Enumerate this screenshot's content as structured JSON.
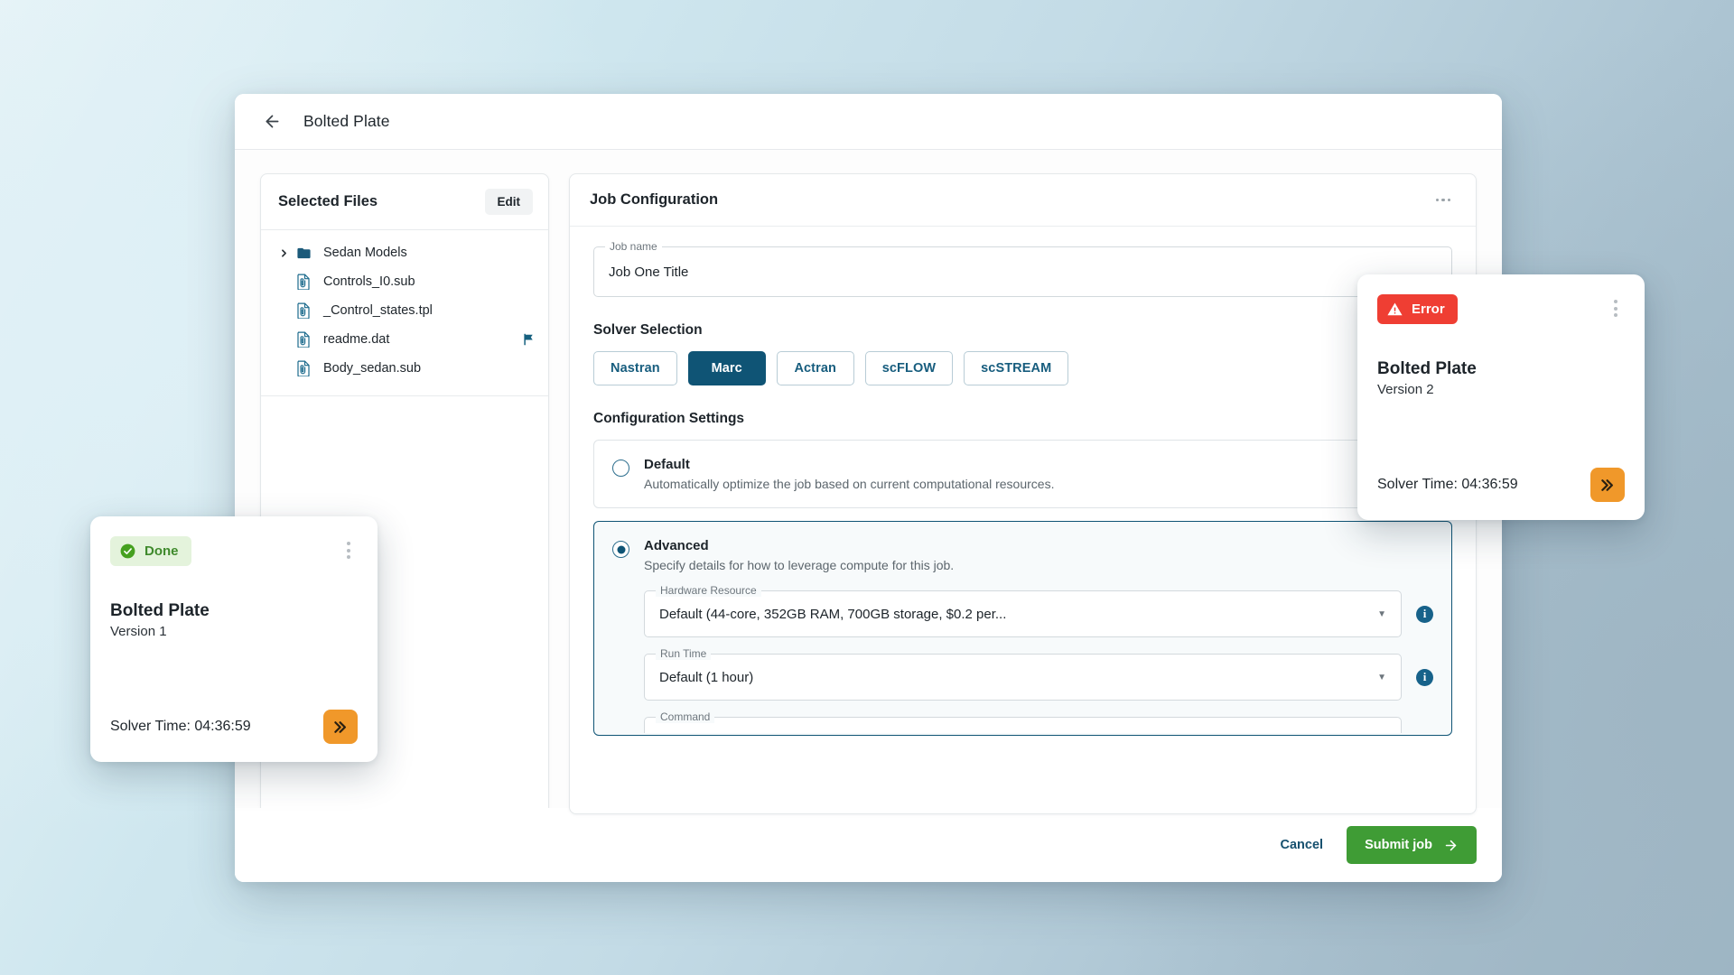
{
  "window": {
    "title": "Bolted Plate",
    "back_icon": "arrow-left-icon"
  },
  "files_panel": {
    "title": "Selected Files",
    "edit_label": "Edit",
    "items": [
      {
        "label": "Sedan Models",
        "type": "folder",
        "icon": "folder-icon",
        "expandable": true,
        "chevron": "chevron-right-icon",
        "flagged": false
      },
      {
        "label": "Controls_I0.sub",
        "type": "file",
        "icon": "file-document-icon",
        "expandable": false,
        "flagged": false
      },
      {
        "label": "_Control_states.tpl",
        "type": "file",
        "icon": "file-document-icon",
        "expandable": false,
        "flagged": false
      },
      {
        "label": "readme.dat",
        "type": "file",
        "icon": "file-document-icon",
        "expandable": false,
        "flagged": true,
        "flag_icon": "flag-icon"
      },
      {
        "label": "Body_sedan.sub",
        "type": "file",
        "icon": "file-document-icon",
        "expandable": false,
        "flagged": false
      }
    ]
  },
  "config_panel": {
    "title": "Job Configuration",
    "overflow_icon": "more-horizontal-icon",
    "job_name": {
      "label": "Job name",
      "value": "Job One Title",
      "placeholder": "Job name"
    },
    "solver_selection": {
      "title": "Solver Selection",
      "options": [
        {
          "label": "Nastran",
          "selected": false
        },
        {
          "label": "Marc",
          "selected": true
        },
        {
          "label": "Actran",
          "selected": false
        },
        {
          "label": "scFLOW",
          "selected": false
        },
        {
          "label": "scSTREAM",
          "selected": false
        }
      ]
    },
    "configuration_settings": {
      "title": "Configuration Settings",
      "options": [
        {
          "id": "default",
          "title": "Default",
          "description": "Automatically optimize the job based on current computational resources.",
          "selected": false
        },
        {
          "id": "advanced",
          "title": "Advanced",
          "description": "Specify details for how to leverage compute for this job.",
          "selected": true
        }
      ],
      "advanced_fields": [
        {
          "label": "Hardware Resource",
          "value": "Default (44-core, 352GB RAM, 700GB storage, $0.2 per...",
          "caret": "chevron-down-icon",
          "info": "info-icon"
        },
        {
          "label": "Run Time",
          "value": "Default (1 hour)",
          "caret": "chevron-down-icon",
          "info": "info-icon"
        }
      ],
      "command_field": {
        "label": "Command",
        "value": ""
      }
    }
  },
  "footer": {
    "cancel_label": "Cancel",
    "submit_label": "Submit job",
    "submit_icon": "arrow-right-icon"
  },
  "job_cards": [
    {
      "id": "done",
      "status": "Done",
      "status_icon": "check-circle-icon",
      "name": "Bolted Plate",
      "version": "Version 1",
      "solver_time": "Solver Time: 04:36:59",
      "action_icon": "fast-forward-icon",
      "menu_icon": "more-vertical-icon"
    },
    {
      "id": "error",
      "status": "Error",
      "status_icon": "alert-triangle-icon",
      "name": "Bolted Plate",
      "version": "Version 2",
      "solver_time": "Solver Time: 04:36:59",
      "action_icon": "fast-forward-icon",
      "menu_icon": "more-vertical-icon"
    }
  ],
  "colors": {
    "brand_dark_blue": "#0f5475",
    "brand_link_blue": "#175d7e",
    "success_green": "#3f9c35",
    "badge_done_bg": "#e4f3dc",
    "badge_done_text": "#3f8a2c",
    "error_red": "#ef3e33",
    "accent_orange": "#f0982a",
    "file_icon_teal": "#1b6a8c"
  }
}
